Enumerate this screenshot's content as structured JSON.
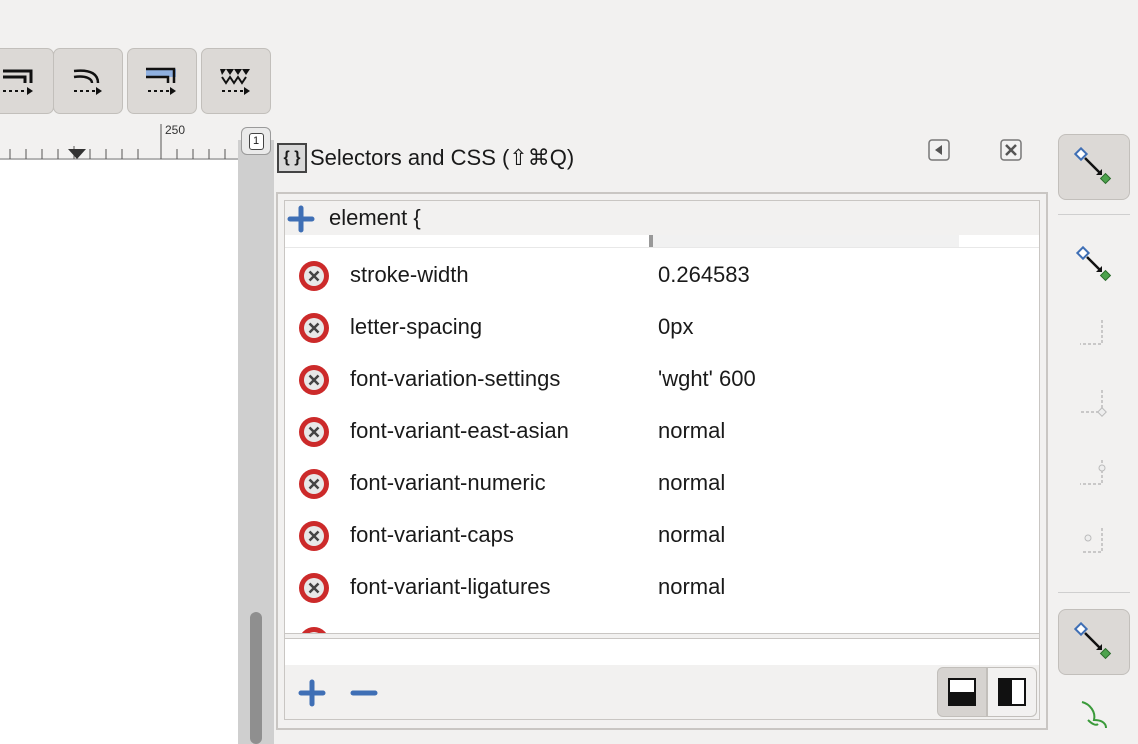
{
  "ruler": {
    "tick_label": "250"
  },
  "canvas": {
    "page_number": "1"
  },
  "dialog": {
    "title": "Selectors and CSS (⇧⌘Q)",
    "selector": "element {",
    "properties": [
      {
        "name": "stroke-width",
        "value": "0.264583"
      },
      {
        "name": "letter-spacing",
        "value": "0px"
      },
      {
        "name": "font-variation-settings",
        "value": "'wght' 600"
      },
      {
        "name": "font-variant-east-asian",
        "value": "normal"
      },
      {
        "name": "font-variant-numeric",
        "value": "normal"
      },
      {
        "name": "font-variant-caps",
        "value": "normal"
      },
      {
        "name": "font-variant-ligatures",
        "value": "normal"
      }
    ]
  },
  "colors": {
    "accent_blue": "#3f6fb5",
    "delete_red": "#cc2a2a",
    "snap_green": "#4da34d"
  },
  "icons": {
    "toolbar": [
      "path-effect-icon",
      "path-curve-icon",
      "path-fill-icon",
      "path-dots-icon"
    ],
    "sidebar": [
      "snap-nodes-icon",
      "snap-nodes-icon",
      "snap-corner-icon",
      "snap-midpoint-icon",
      "snap-center-icon",
      "snap-dot-icon",
      "snap-nodes-icon",
      "snap-curve-icon"
    ]
  }
}
